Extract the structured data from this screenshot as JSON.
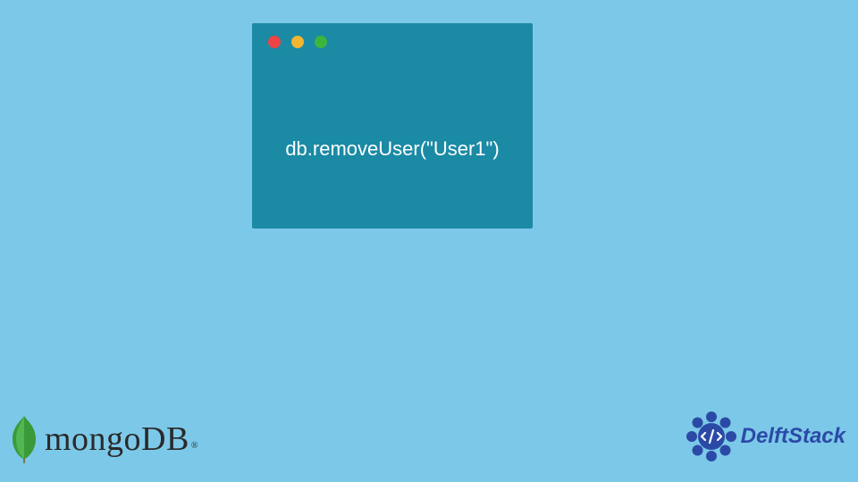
{
  "code_window": {
    "code_line": "db.removeUser(\"User1\")"
  },
  "mongo": {
    "text": "mongoDB",
    "reg": "®"
  },
  "delft": {
    "text": "DelftStack"
  }
}
